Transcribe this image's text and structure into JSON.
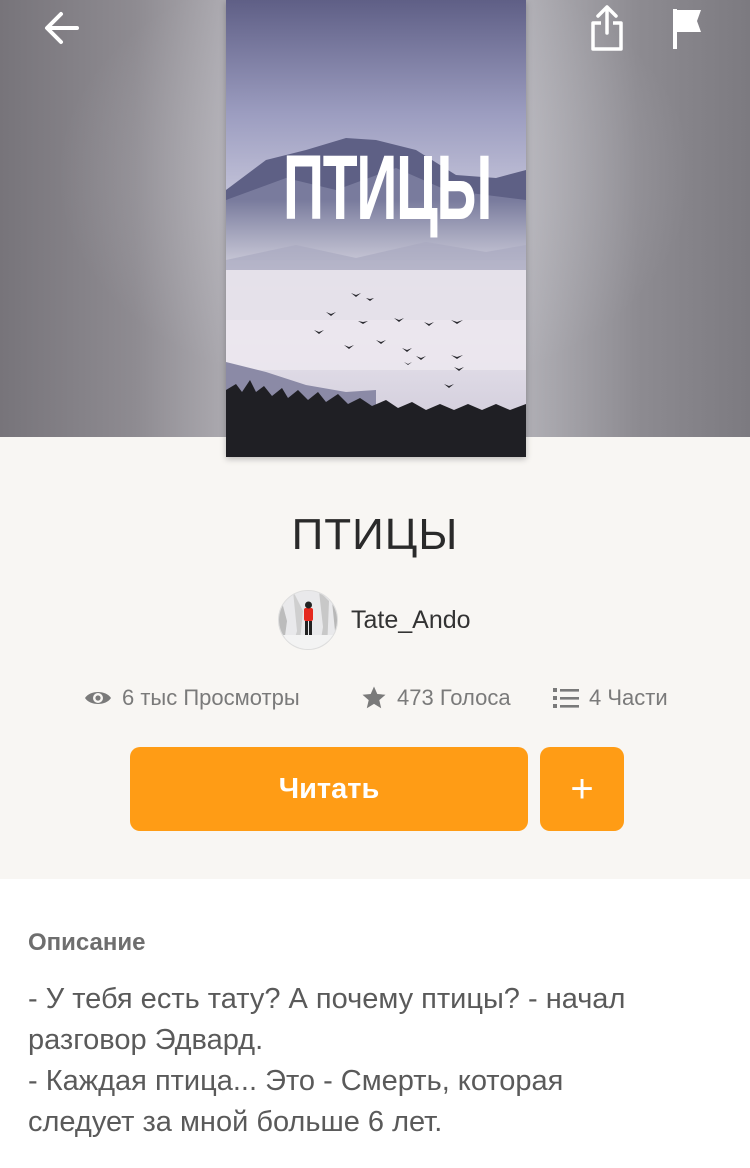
{
  "header": {
    "back_icon": "arrow-left-icon",
    "share_icon": "share-icon",
    "flag_icon": "flag-icon"
  },
  "cover": {
    "title_text": "ПТИЦЫ"
  },
  "story": {
    "title": "ПТИЦЫ",
    "author": "Tate_Ando"
  },
  "stats": {
    "views": "6 тыс Просмотры",
    "votes": "473 Голоса",
    "parts": "4 Части"
  },
  "actions": {
    "read_label": "Читать",
    "add_label": "+"
  },
  "description": {
    "heading": "Описание",
    "lines": [
      "- У тебя есть тату? А почему птицы? - начал",
      "разговор Эдвард.",
      "- Каждая птица... Это - Смерть, которая",
      "следует за мной больше 6 лет."
    ]
  },
  "colors": {
    "accent": "#ff9c15",
    "background": "#f8f6f3"
  }
}
